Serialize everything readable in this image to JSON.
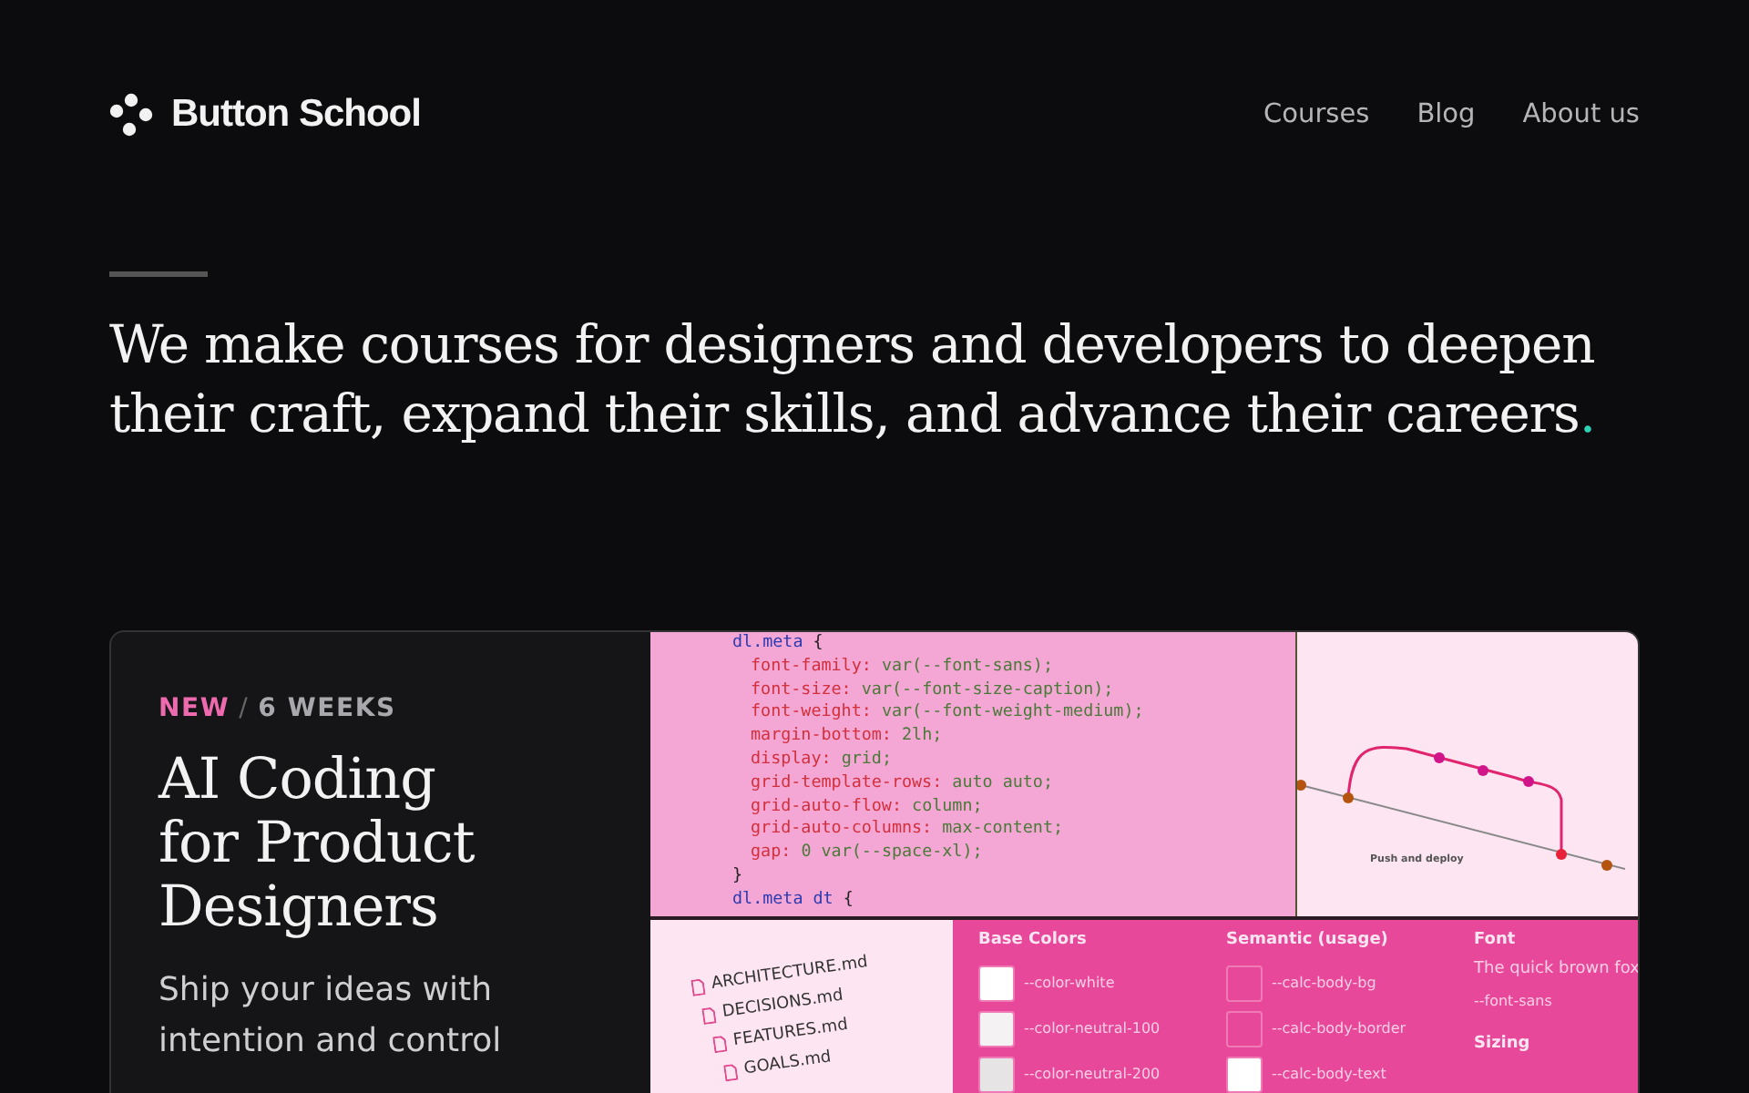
{
  "header": {
    "logo": "Button School",
    "nav": [
      {
        "label": "Courses"
      },
      {
        "label": "Blog"
      },
      {
        "label": "About us"
      }
    ]
  },
  "intro": {
    "text": "We make courses for designers and developers to deepen their craft, expand their skills, and advance their careers",
    "end_mark": "."
  },
  "course": {
    "badge": "NEW",
    "separator": "/",
    "duration": "6 WEEKS",
    "title": "AI Coding for Product Designers",
    "subtitle": "Ship your ideas with intention and control",
    "code_lines": [
      {
        "kind": "open",
        "selector": "dl.meta",
        "brace": "{"
      },
      {
        "kind": "decl",
        "property": "font-family:",
        "value": "var(--font-sans);"
      },
      {
        "kind": "decl",
        "property": "font-size:",
        "value": "var(--font-size-caption);"
      },
      {
        "kind": "decl",
        "property": "font-weight:",
        "value": "var(--font-weight-medium);"
      },
      {
        "kind": "decl",
        "property": "margin-bottom:",
        "value": "2lh;"
      },
      {
        "kind": "decl",
        "property": "display:",
        "value": "grid;"
      },
      {
        "kind": "decl",
        "property": "grid-template-rows:",
        "value": "auto auto;"
      },
      {
        "kind": "decl",
        "property": "grid-auto-flow:",
        "value": "column;"
      },
      {
        "kind": "decl",
        "property": "grid-auto-columns:",
        "value": "max-content;"
      },
      {
        "kind": "decl",
        "property": "gap:",
        "value": "0 var(--space-xl);"
      },
      {
        "kind": "close",
        "brace": "}"
      },
      {
        "kind": "open",
        "selector": "dl.meta dt",
        "brace": "{"
      }
    ],
    "diagram_label": "Push and deploy",
    "files": [
      "ARCHITECTURE.md",
      "DECISIONS.md",
      "FEATURES.md",
      "GOALS.md"
    ],
    "token_columns": [
      {
        "heading": "Base Colors",
        "kind": "swatches",
        "items": [
          {
            "name": "--color-white",
            "color": "#ffffff"
          },
          {
            "name": "--color-neutral-100",
            "color": "#f4f2f3"
          },
          {
            "name": "--color-neutral-200",
            "color": "#e6e4e5"
          }
        ]
      },
      {
        "heading": "Semantic (usage)",
        "kind": "swatches",
        "items": [
          {
            "name": "--calc-body-bg",
            "color": "#e8489a"
          },
          {
            "name": "--calc-body-border",
            "color": "#e8489a"
          },
          {
            "name": "--calc-body-text",
            "color": "#ffffff"
          }
        ]
      },
      {
        "heading": "Font",
        "kind": "font",
        "sample": "The quick brown fox",
        "token": "--font-sans",
        "next_heading": "Sizing"
      }
    ]
  }
}
